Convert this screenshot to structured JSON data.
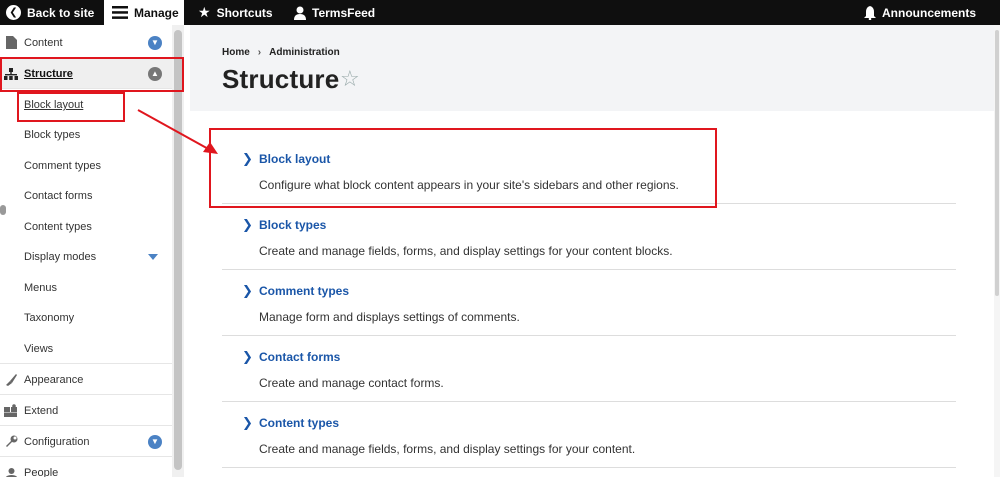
{
  "toolbar": {
    "back": "Back to site",
    "manage": "Manage",
    "shortcuts": "Shortcuts",
    "user": "TermsFeed",
    "announcements": "Announcements"
  },
  "sidebar": {
    "content": "Content",
    "structure": "Structure",
    "sub": [
      "Block layout",
      "Block types",
      "Comment types",
      "Contact forms",
      "Content types",
      "Display modes",
      "Menus",
      "Taxonomy",
      "Views"
    ],
    "appearance": "Appearance",
    "extend": "Extend",
    "configuration": "Configuration",
    "people": "People"
  },
  "breadcrumb": {
    "home": "Home",
    "sep": "›",
    "admin": "Administration"
  },
  "page": {
    "title": "Structure",
    "star": "☆"
  },
  "items": [
    {
      "title": "Block layout",
      "desc": "Configure what block content appears in your site's sidebars and other regions."
    },
    {
      "title": "Block types",
      "desc": "Create and manage fields, forms, and display settings for your content blocks."
    },
    {
      "title": "Comment types",
      "desc": "Manage form and displays settings of comments."
    },
    {
      "title": "Contact forms",
      "desc": "Create and manage contact forms."
    },
    {
      "title": "Content types",
      "desc": "Create and manage fields, forms, and display settings for your content."
    }
  ],
  "colors": {
    "accent": "#e0161e",
    "link": "#1a56a8"
  }
}
